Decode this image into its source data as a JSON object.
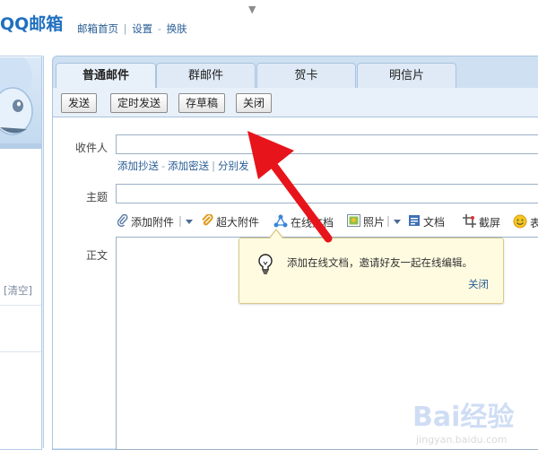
{
  "header": {
    "logo": "QQ邮箱",
    "links": [
      "邮箱首页",
      "设置",
      "换肤"
    ],
    "link_separators": [
      "|",
      "-"
    ],
    "dropdown_icon": "▼"
  },
  "sidebar": {
    "clear_label": "[清空]"
  },
  "tabs": [
    {
      "label": "普通邮件",
      "active": true
    },
    {
      "label": "群邮件",
      "active": false
    },
    {
      "label": "贺卡",
      "active": false
    },
    {
      "label": "明信片",
      "active": false
    }
  ],
  "toolbar": {
    "send": "发送",
    "scheduled_send": "定时发送",
    "save_draft": "存草稿",
    "close": "关闭"
  },
  "form": {
    "to_label": "收件人",
    "cc_links": [
      "添加抄送",
      "添加密送",
      "分别发"
    ],
    "subject_label": "主题",
    "body_label": "正文"
  },
  "attachments": [
    {
      "icon": "paperclip-icon",
      "label": "添加附件"
    },
    {
      "icon": "large-attachment-icon",
      "label": "超大附件"
    },
    {
      "icon": "online-doc-icon",
      "label": "在线文档"
    },
    {
      "icon": "photo-icon",
      "label": "照片"
    },
    {
      "icon": "document-icon",
      "label": "文档"
    },
    {
      "icon": "screenshot-icon",
      "label": "截屏"
    },
    {
      "icon": "emoji-icon",
      "label": "表"
    }
  ],
  "tooltip": {
    "icon": "lightbulb-icon",
    "text": "添加在线文档，邀请好友一起在线编辑。",
    "close": "关闭"
  },
  "watermark": {
    "text": "Bai经验",
    "url": "jingyan.baidu.com"
  },
  "colors": {
    "accent": "#1f6fbf",
    "link": "#2a5e96",
    "annotation_arrow": "#e8141b"
  }
}
